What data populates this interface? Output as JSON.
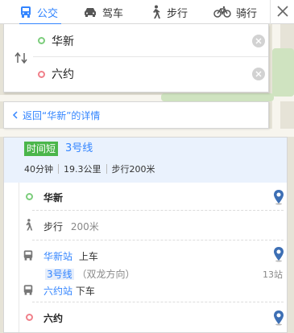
{
  "tabs": [
    {
      "label": "公交",
      "icon": "bus-icon",
      "active": true
    },
    {
      "label": "驾车",
      "icon": "car-icon",
      "active": false
    },
    {
      "label": "步行",
      "icon": "walk-icon",
      "active": false
    },
    {
      "label": "骑行",
      "icon": "bike-icon",
      "active": false
    }
  ],
  "route": {
    "start": "华新",
    "end": "六约"
  },
  "back_link": "返回“华新”的详情",
  "plan": {
    "badge": "时间短",
    "line": "3号线",
    "duration": "40分钟",
    "distance": "19.3公里",
    "walk": "步行200米"
  },
  "steps": {
    "start_name": "华新",
    "walk_label": "步行",
    "walk_distance": "200米",
    "board_station": "华新站",
    "board_action": "上车",
    "line_tag": "3号线",
    "direction": "（双龙方向）",
    "stops": "13站",
    "alight_station": "六约站",
    "alight_action": "下车",
    "end_name": "六约"
  },
  "colors": {
    "accent": "#3385ff",
    "badge_green": "#4bb64b",
    "start_dot": "#7ccd7c",
    "end_dot": "#f0808a"
  }
}
